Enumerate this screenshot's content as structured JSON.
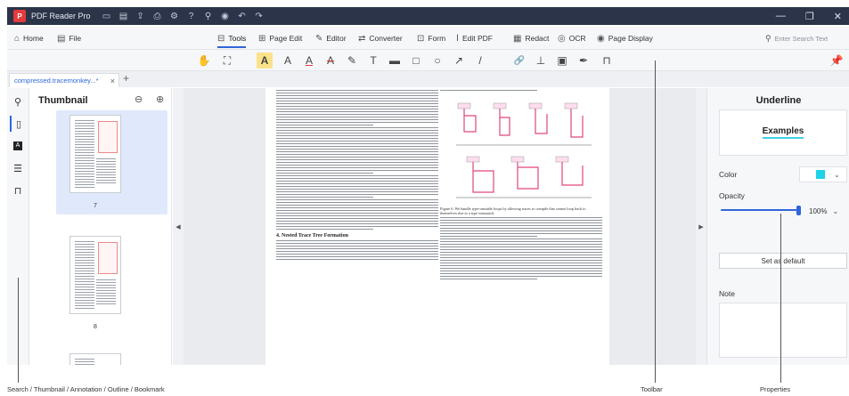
{
  "titlebar": {
    "app_name": "PDF Reader Pro",
    "logo_glyph": "P",
    "quick_icons": [
      "folder-icon",
      "save-icon",
      "share-icon",
      "print-icon",
      "gear-icon",
      "help-icon",
      "link-icon",
      "record-icon",
      "undo-icon",
      "redo-icon"
    ],
    "window_controls": [
      "minimize-icon",
      "restore-icon",
      "close-icon"
    ]
  },
  "menu": {
    "home": "Home",
    "file": "File",
    "tabs": [
      {
        "label": "Tools",
        "icon": "toolbox-icon",
        "active": true
      },
      {
        "label": "Page Edit",
        "icon": "grid-icon"
      },
      {
        "label": "Editor",
        "icon": "edit-icon"
      },
      {
        "label": "Converter",
        "icon": "convert-icon"
      },
      {
        "label": "Form",
        "icon": "form-icon"
      },
      {
        "label": "Edit PDF",
        "icon": "text-cursor-icon"
      },
      {
        "label": "Redact",
        "icon": "redact-icon"
      },
      {
        "label": "OCR",
        "icon": "ocr-icon"
      },
      {
        "label": "Page Display",
        "icon": "eye-icon"
      }
    ],
    "search_placeholder": "Enter Search Text"
  },
  "toolbar": {
    "tools": [
      {
        "name": "hand-tool-icon",
        "glyph": "✋"
      },
      {
        "name": "select-tool-icon",
        "glyph": "⛶"
      },
      {
        "name": "highlight-tool-icon",
        "glyph": "A",
        "active": true
      },
      {
        "name": "text-color-tool-icon",
        "glyph": "A"
      },
      {
        "name": "underline-tool-icon",
        "glyph": "A"
      },
      {
        "name": "strikethrough-tool-icon",
        "glyph": "A"
      },
      {
        "name": "pen-tool-icon",
        "glyph": "✎"
      },
      {
        "name": "text-tool-icon",
        "glyph": "T"
      },
      {
        "name": "note-tool-icon",
        "glyph": "▬"
      },
      {
        "name": "rectangle-tool-icon",
        "glyph": "□"
      },
      {
        "name": "circle-tool-icon",
        "glyph": "○"
      },
      {
        "name": "arrow-tool-icon",
        "glyph": "↗"
      },
      {
        "name": "line-tool-icon",
        "glyph": "/"
      },
      {
        "name": "link-tool-icon",
        "glyph": "🔗"
      },
      {
        "name": "stamp-tool-icon",
        "glyph": "⊥"
      },
      {
        "name": "image-tool-icon",
        "glyph": "▣"
      },
      {
        "name": "signature-tool-icon",
        "glyph": "✒"
      },
      {
        "name": "bookmark-tool-icon",
        "glyph": "⊓"
      }
    ],
    "pin_icon": "pin-icon"
  },
  "document_tab": {
    "title": "compressed.tracemonkey...*",
    "close": "×",
    "new_tab": "+"
  },
  "rail": {
    "icons": [
      "search-icon",
      "thumbnail-icon",
      "annotation-icon",
      "outline-icon",
      "bookmark-icon"
    ]
  },
  "thumbnails": {
    "title": "Thumbnail",
    "pages": [
      "7",
      "8"
    ]
  },
  "document": {
    "section_heading": "4.   Nested Trace Tree Formation",
    "figure_caption": "Figure 6. We handle type-unstable loops by allowing traces to compile that cannot loop back to themselves due to a type mismatch."
  },
  "properties": {
    "title": "Underline",
    "example_text": "Examples",
    "color_label": "Color",
    "color_value": "#1ed2e8",
    "opacity_label": "Opacity",
    "opacity_value": "100%",
    "opacity_fraction": 1.0,
    "default_button": "Set as default",
    "note_label": "Note"
  },
  "callouts": {
    "left": "Search / Thumbnail / Annotation / Outline / Bookmark",
    "toolbar": "Toolbar",
    "properties": "Properties"
  }
}
